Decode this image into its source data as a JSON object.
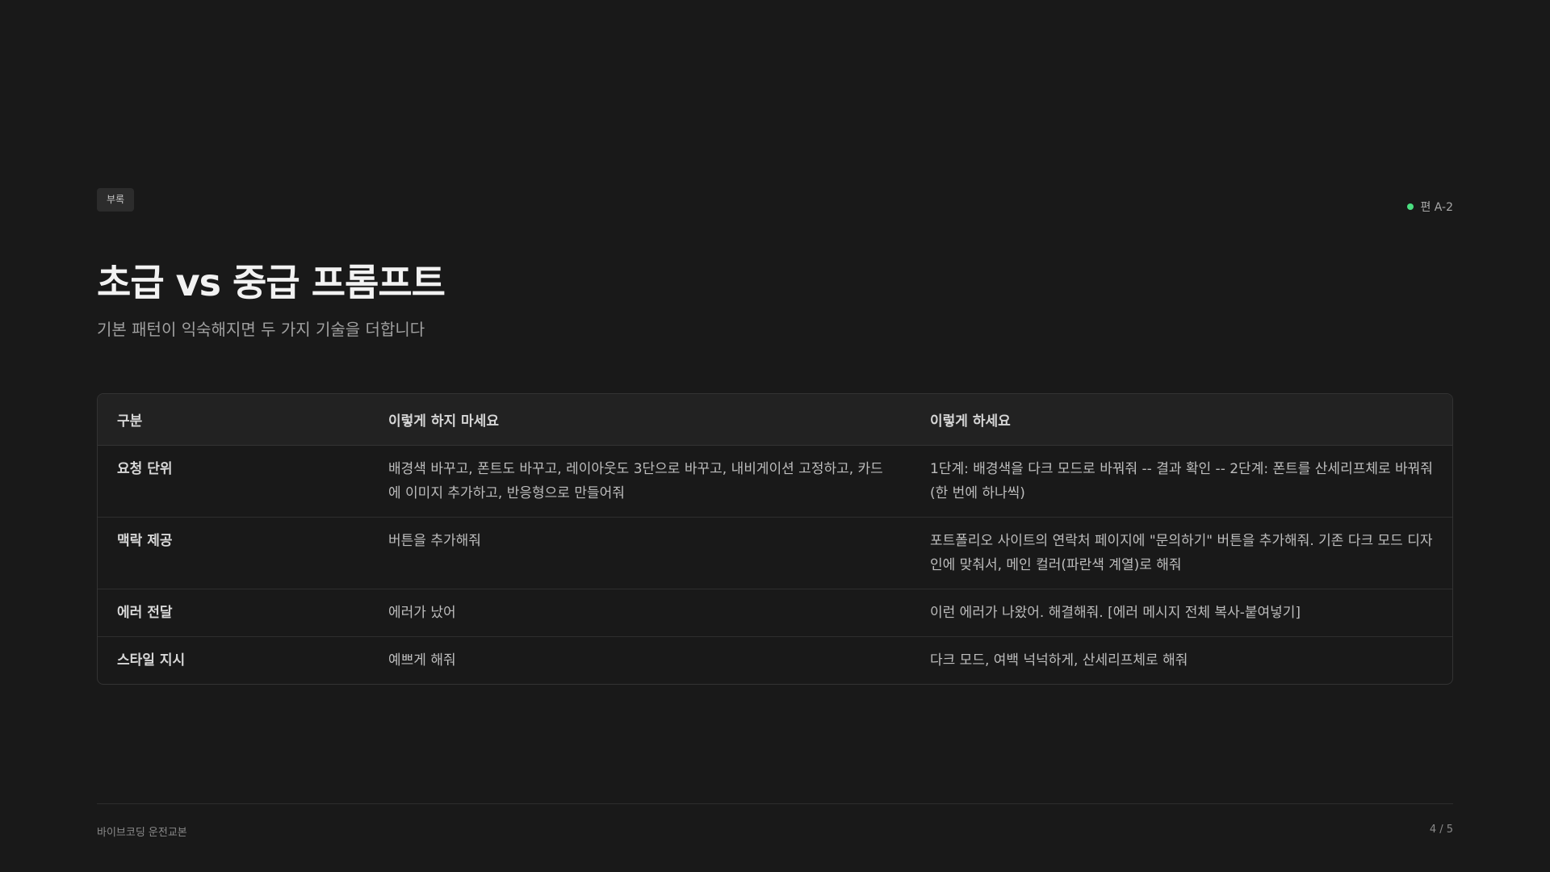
{
  "badge": "부록",
  "section_tag": {
    "label": "편 A-2",
    "dot_color": "#4ade80"
  },
  "title": "초급 vs 중급 프롬프트",
  "subtitle": "기본 패턴이 익숙해지면 두 가지 기술을 더합니다",
  "table": {
    "headers": [
      "구분",
      "이렇게 하지 마세요",
      "이렇게 하세요"
    ],
    "rows": [
      {
        "category": "요청 단위",
        "dont": "배경색 바꾸고, 폰트도 바꾸고, 레이아웃도 3단으로 바꾸고, 내비게이션 고정하고, 카드에 이미지 추가하고, 반응형으로 만들어줘",
        "do": "1단계: 배경색을 다크 모드로 바꿔줘 -- 결과 확인 -- 2단계: 폰트를 산세리프체로 바꿔줘 (한 번에 하나씩)"
      },
      {
        "category": "맥락 제공",
        "dont": "버튼을 추가해줘",
        "do": "포트폴리오 사이트의 연락처 페이지에 \"문의하기\" 버튼을 추가해줘. 기존 다크 모드 디자인에 맞춰서, 메인 컬러(파란색 계열)로 해줘"
      },
      {
        "category": "에러 전달",
        "dont": "에러가 났어",
        "do": "이런 에러가 나왔어. 해결해줘. [에러 메시지 전체 복사-붙여넣기]"
      },
      {
        "category": "스타일 지시",
        "dont": "예쁘게 해줘",
        "do": "다크 모드, 여백 넉넉하게, 산세리프체로 해줘"
      }
    ]
  },
  "footer": {
    "left": "바이브코딩 운전교본",
    "right": "4 / 5"
  }
}
